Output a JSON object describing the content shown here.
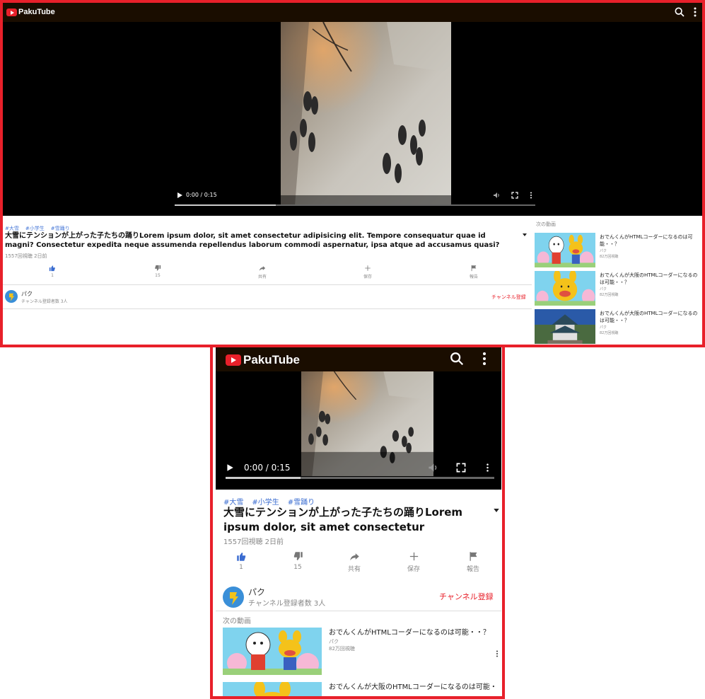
{
  "app": {
    "name": "PakuTube"
  },
  "colors": {
    "accent": "#e8202a",
    "topbar": "#1a0d00",
    "tag": "#3a6cd0",
    "like_active": "#3a6cd0"
  },
  "icons": {
    "search": "search-icon",
    "more": "more-vert-icon",
    "like": "thumbs-up-icon",
    "dislike": "thumbs-down-icon",
    "share": "share-icon",
    "save": "plus-icon",
    "report": "flag-icon"
  },
  "video": {
    "tags": [
      "#大雪",
      "#小学生",
      "#雪踊り"
    ],
    "title": "大雪にテンションが上がった子たちの踊りLorem ipsum dolor, sit amet consectetur adipisicing elit. Tempore consequatur quae id magni? Consectetur expedita neque assumenda repellendus laborum commodi aspernatur, ipsa atque ad accusamus quasi? Minus, blanditiis. Reprehenderit, quibusdam.",
    "views": "1557回視聴",
    "age": "2日前",
    "time_display": "0:00 / 0:15",
    "progress": 0.28
  },
  "actions": [
    {
      "key": "like",
      "label": "1"
    },
    {
      "key": "dislike",
      "label": "15"
    },
    {
      "key": "share",
      "label": "共有"
    },
    {
      "key": "save",
      "label": "保存"
    },
    {
      "key": "report",
      "label": "報告"
    }
  ],
  "channel": {
    "name": "パク",
    "subscribers": "チャンネル登録者数 3人",
    "subscribe_label": "チャンネル登録"
  },
  "up_next": {
    "heading": "次の動画",
    "items": [
      {
        "title": "おでんくんがHTMLコーダーになるのは可能・・？",
        "channel": "パク",
        "views": "82万回視聴"
      },
      {
        "title": "おでんくんが大阪のHTMLコーダーになるのは可能・・？",
        "channel": "パク",
        "views": "82万回視聴"
      },
      {
        "title": "おでんくんが大阪のHTMLコーダーになるのは可能・・？",
        "channel": "パク",
        "views": "82万回視聴"
      }
    ]
  }
}
